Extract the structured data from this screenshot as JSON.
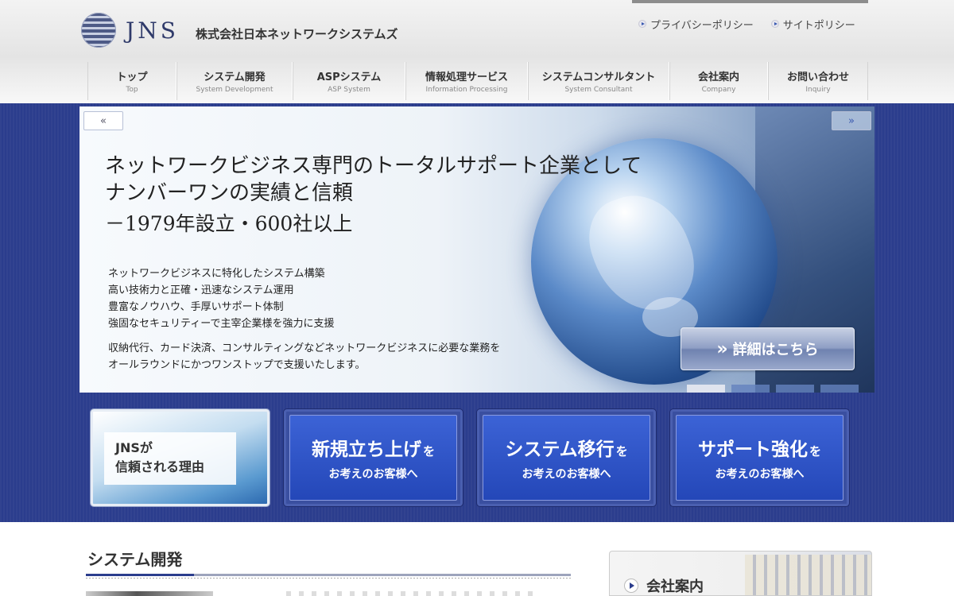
{
  "header": {
    "logo_text": "JNS",
    "company_name": "株式会社日本ネットワークシステムズ",
    "utility_links": [
      "プライバシーポリシー",
      "サイトポリシー"
    ]
  },
  "nav": [
    {
      "jp": "トップ",
      "en": "Top"
    },
    {
      "jp": "システム開発",
      "en": "System Development"
    },
    {
      "jp": "ASPシステム",
      "en": "ASP System"
    },
    {
      "jp": "情報処理サービス",
      "en": "Information Processing"
    },
    {
      "jp": "システムコンサルタント",
      "en": "System Consultant"
    },
    {
      "jp": "会社案内",
      "en": "Company"
    },
    {
      "jp": "お問い合わせ",
      "en": "Inquiry"
    }
  ],
  "hero": {
    "prev_label": "«",
    "next_label": "»",
    "title_line1": "ネットワークビジネス専門のトータルサポート企業として",
    "title_line2": "ナンバーワンの実績と信頼",
    "subtitle": "－1979年設立・600社以上",
    "points": [
      "ネットワークビジネスに特化したシステム構築",
      "高い技術力と正確・迅速なシステム運用",
      "豊富なノウハウ、手厚いサポート体制",
      "強固なセキュリティーで主宰企業様を強力に支援"
    ],
    "desc_line1": "収納代行、カード決済、コンサルティングなどネットワークビジネスに必要な業務を",
    "desc_line2": "オールラウンドにかつワンストップで支援いたします。",
    "detail_button": "詳細はこちら",
    "slide_count": 4,
    "active_slide": 1
  },
  "features": {
    "first": {
      "line1": "JNSが",
      "line2": "信頼される理由"
    },
    "boxes": [
      {
        "main": "新規立ち上げ",
        "particle": "を",
        "sub": "お考えのお客様へ"
      },
      {
        "main": "システム移行",
        "particle": "を",
        "sub": "お考えのお客様へ"
      },
      {
        "main": "サポート強化",
        "particle": "を",
        "sub": "お考えのお客様へ"
      }
    ]
  },
  "main": {
    "section_title": "システム開発",
    "company_card": "会社案内"
  },
  "colors": {
    "brand_navy": "#2b3d8d",
    "feature_blue": "#2447b8"
  }
}
